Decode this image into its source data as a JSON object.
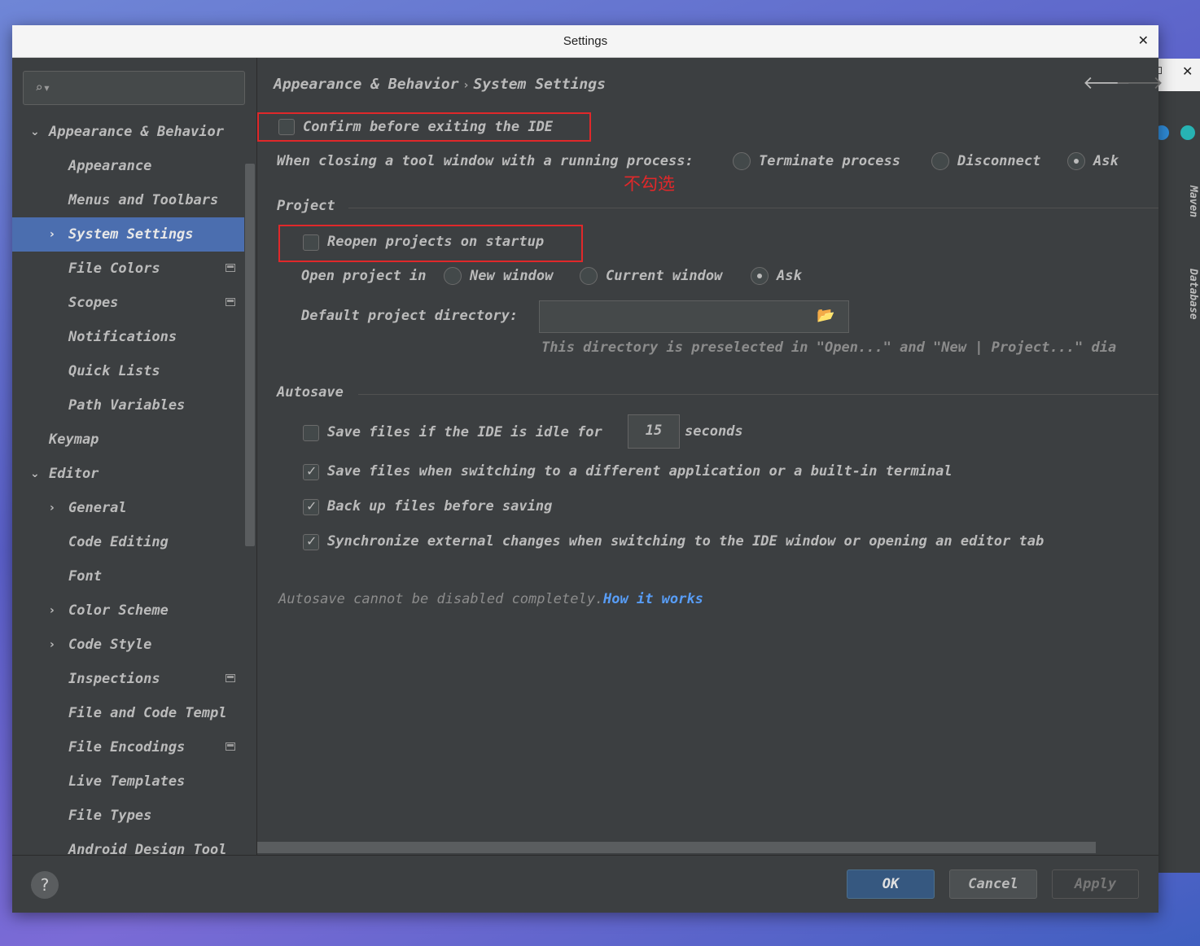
{
  "window": {
    "title": "Settings"
  },
  "search": {
    "placeholder": ""
  },
  "annotation": {
    "text": "不勾选"
  },
  "sidebar": {
    "items": [
      {
        "label": "Appearance & Behavior"
      },
      {
        "label": "Appearance"
      },
      {
        "label": "Menus and Toolbars"
      },
      {
        "label": "System Settings"
      },
      {
        "label": "File Colors"
      },
      {
        "label": "Scopes"
      },
      {
        "label": "Notifications"
      },
      {
        "label": "Quick Lists"
      },
      {
        "label": "Path Variables"
      },
      {
        "label": "Keymap"
      },
      {
        "label": "Editor"
      },
      {
        "label": "General"
      },
      {
        "label": "Code Editing"
      },
      {
        "label": "Font"
      },
      {
        "label": "Color Scheme"
      },
      {
        "label": "Code Style"
      },
      {
        "label": "Inspections"
      },
      {
        "label": "File and Code Templ"
      },
      {
        "label": "File Encodings"
      },
      {
        "label": "Live Templates"
      },
      {
        "label": "File Types"
      },
      {
        "label": "Android Design Tool"
      }
    ]
  },
  "breadcrumb": {
    "parent": "Appearance & Behavior",
    "current": "System Settings"
  },
  "settings": {
    "confirm_exit": {
      "label": "Confirm before exiting the IDE",
      "checked": false
    },
    "tool_window": {
      "label": "When closing a tool window with a running process:",
      "options": [
        "Terminate process",
        "Disconnect",
        "Ask"
      ],
      "selected": "Ask"
    },
    "project": {
      "section": "Project",
      "reopen": {
        "label": "Reopen projects on startup",
        "checked": false
      },
      "open_in": {
        "label": "Open project in",
        "options": [
          "New window",
          "Current window",
          "Ask"
        ],
        "selected": "Ask"
      },
      "default_dir": {
        "label": "Default project directory:",
        "value": "",
        "hint": "This directory is preselected in \"Open...\" and \"New | Project...\" dia"
      }
    },
    "autosave": {
      "section": "Autosave",
      "idle": {
        "label_before": "Save files if the IDE is idle for",
        "value": "15",
        "label_after": "seconds",
        "checked": false
      },
      "switch_app": {
        "label": "Save files when switching to a different application or a built-in terminal",
        "checked": true
      },
      "backup": {
        "label": "Back up files before saving",
        "checked": true
      },
      "sync": {
        "label": "Synchronize external changes when switching to the IDE window or opening an editor tab",
        "checked": true
      },
      "note": "Autosave cannot be disabled completely.",
      "link": "How it works"
    }
  },
  "footer": {
    "help": "?",
    "ok": "OK",
    "cancel": "Cancel",
    "apply": "Apply"
  },
  "background_ide": {
    "maven": "Maven",
    "database": "Database"
  }
}
